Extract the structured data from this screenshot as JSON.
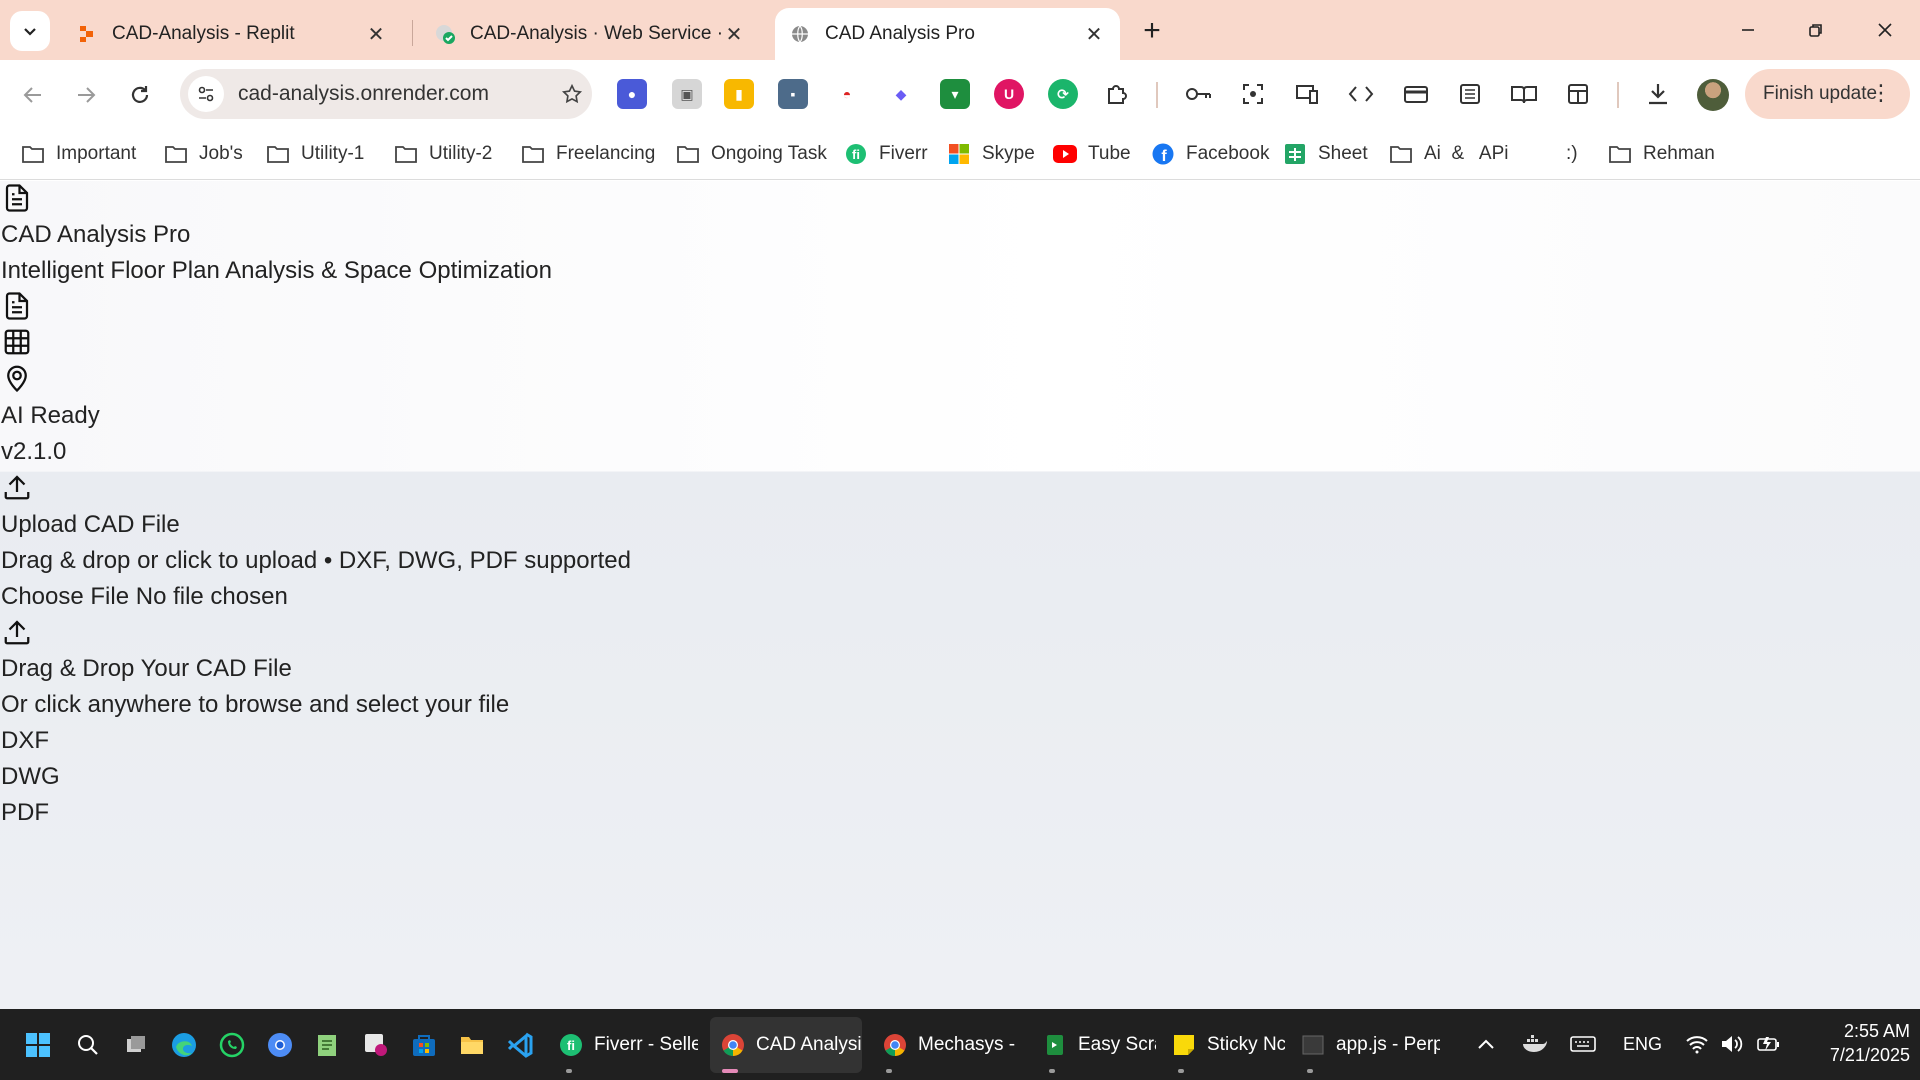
{
  "browser": {
    "tabs": [
      {
        "title": "CAD-Analysis - Replit",
        "icon": "replit-icon"
      },
      {
        "title": "CAD-Analysis · Web Service · R",
        "icon": "render-icon"
      },
      {
        "title": "CAD Analysis Pro",
        "icon": "globe-icon",
        "active": true
      }
    ],
    "url": "cad-analysis.onrender.com",
    "finish_update": "Finish update"
  },
  "bookmarks": [
    {
      "label": "Important",
      "icon": "folder-icon"
    },
    {
      "label": "Job's",
      "icon": "folder-icon"
    },
    {
      "label": "Utility-1",
      "icon": "folder-icon"
    },
    {
      "label": "Utility-2",
      "icon": "folder-icon"
    },
    {
      "label": "Freelancing",
      "icon": "folder-icon"
    },
    {
      "label": "Ongoing Task",
      "icon": "folder-icon"
    },
    {
      "label": "Fiverr",
      "icon": "fiverr-icon"
    },
    {
      "label": "Skype",
      "icon": "microsoft-icon"
    },
    {
      "label": "Tube",
      "icon": "youtube-icon"
    },
    {
      "label": "Facebook",
      "icon": "facebook-icon"
    },
    {
      "label": "Sheet",
      "icon": "sheets-icon"
    },
    {
      "label": "Ai  &   APi",
      "icon": "folder-icon"
    },
    {
      "label": ":)",
      "icon": ""
    },
    {
      "label": "Rehman",
      "icon": "folder-icon"
    }
  ],
  "app": {
    "title": "CAD Analysis Pro",
    "subtitle": "Intelligent Floor Plan Analysis & Space Optimization",
    "status": "AI Ready",
    "version": "v2.1.0",
    "upload": {
      "title": "Upload CAD File",
      "description": "Drag & drop or click to upload • DXF, DWG, PDF supported",
      "file_button": "Choose File",
      "file_status": "No file chosen",
      "drop_title": "Drag & Drop Your CAD File",
      "drop_hint": "Or click anywhere to browse and select your file",
      "formats": [
        "DXF",
        "DWG",
        "PDF"
      ]
    }
  },
  "taskbar": {
    "apps": [
      {
        "label": "Fiverr - Selle"
      },
      {
        "label": "CAD Analysi:"
      },
      {
        "label": "Mechasys - ("
      },
      {
        "label": "Easy Scra"
      },
      {
        "label": "Sticky Nc"
      },
      {
        "label": "app.js - Perp"
      }
    ],
    "language": "ENG",
    "time": "2:55 AM",
    "date": "7/21/2025"
  },
  "colors": {
    "tab_strip": "#f9d9cc",
    "omnibox": "#efe9e7",
    "page_bg": "#eef0f4",
    "taskbar": "#202020"
  }
}
